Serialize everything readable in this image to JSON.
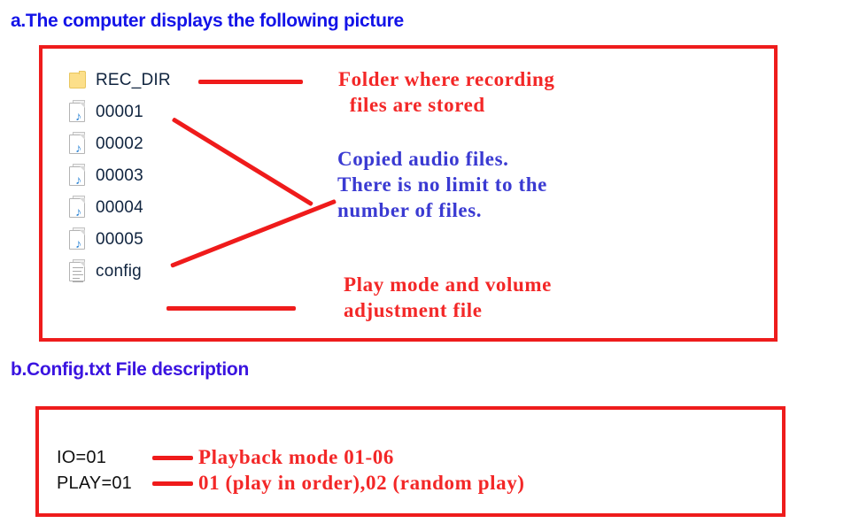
{
  "sections": {
    "a": {
      "heading": "a.The computer displays the following picture"
    },
    "b": {
      "heading": "b.Config.txt File description"
    }
  },
  "file_explorer": {
    "items": [
      {
        "name": "REC_DIR",
        "icon": "folder-icon",
        "type": "folder"
      },
      {
        "name": "00001",
        "icon": "audio-file-icon",
        "type": "audio"
      },
      {
        "name": "00002",
        "icon": "audio-file-icon",
        "type": "audio"
      },
      {
        "name": "00003",
        "icon": "audio-file-icon",
        "type": "audio"
      },
      {
        "name": "00004",
        "icon": "audio-file-icon",
        "type": "audio"
      },
      {
        "name": "00005",
        "icon": "audio-file-icon",
        "type": "audio"
      },
      {
        "name": "config",
        "icon": "text-file-icon",
        "type": "text"
      }
    ]
  },
  "annotations": {
    "folder": {
      "text": "Folder where recording\n  files are stored",
      "color": "#f32727",
      "target": "REC_DIR"
    },
    "audio": {
      "text": "Copied audio files.\nThere is no limit to the\nnumber of files.",
      "color": "#3a3ad2",
      "target": "00001-00005"
    },
    "config": {
      "text": "Play mode and volume\nadjustment file",
      "color": "#f32727",
      "target": "config"
    }
  },
  "config_file": {
    "rows": [
      {
        "key": "IO=01",
        "value": "Playback mode 01-06"
      },
      {
        "key": "PLAY=01",
        "value": "01 (play in order),02 (random play)"
      }
    ]
  },
  "colors": {
    "heading_a": "#1313e8",
    "heading_b": "#3a14e0",
    "panel_border": "#ee1c1c",
    "leader_line": "#ef1b1b",
    "annotation_red": "#f32727",
    "annotation_blue": "#3a3ad2",
    "file_label": "#10243f"
  }
}
